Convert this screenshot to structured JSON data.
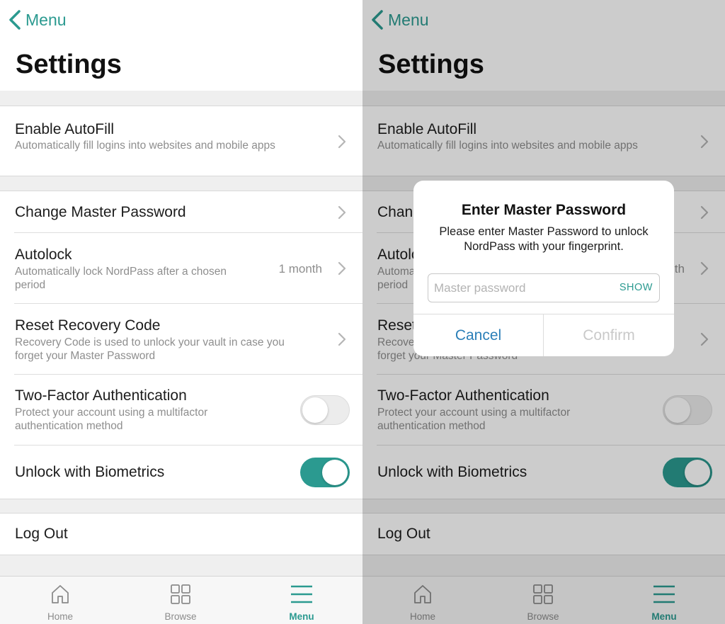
{
  "header": {
    "back_label": "Menu",
    "title": "Settings"
  },
  "settings": {
    "enable_autofill": {
      "title": "Enable AutoFill",
      "subtitle": "Automatically fill logins into websites and mobile apps"
    },
    "change_master_password": {
      "title": "Change Master Password"
    },
    "autolock": {
      "title": "Autolock",
      "subtitle": "Automatically lock NordPass after a chosen period",
      "value": "1 month"
    },
    "reset_recovery_code": {
      "title": "Reset Recovery Code",
      "subtitle": "Recovery Code is used to unlock your vault in case you forget your Master Password"
    },
    "two_factor": {
      "title": "Two-Factor Authentication",
      "subtitle": "Protect your account using a multifactor authentication method",
      "enabled": false
    },
    "biometrics": {
      "title": "Unlock with Biometrics",
      "enabled": true
    },
    "log_out": {
      "title": "Log Out"
    }
  },
  "tabbar": {
    "home": "Home",
    "browse": "Browse",
    "menu": "Menu",
    "active": "menu"
  },
  "dialog": {
    "title": "Enter Master Password",
    "message": "Please enter Master Password to unlock NordPass with your fingerprint.",
    "input_placeholder": "Master password",
    "input_value": "",
    "show_label": "SHOW",
    "cancel_label": "Cancel",
    "confirm_label": "Confirm"
  },
  "colors": {
    "accent": "#2b9a90",
    "dialog_button": "#2b7fb8",
    "disabled": "#c9c9c9",
    "secondary_text": "#8e8e8e"
  }
}
